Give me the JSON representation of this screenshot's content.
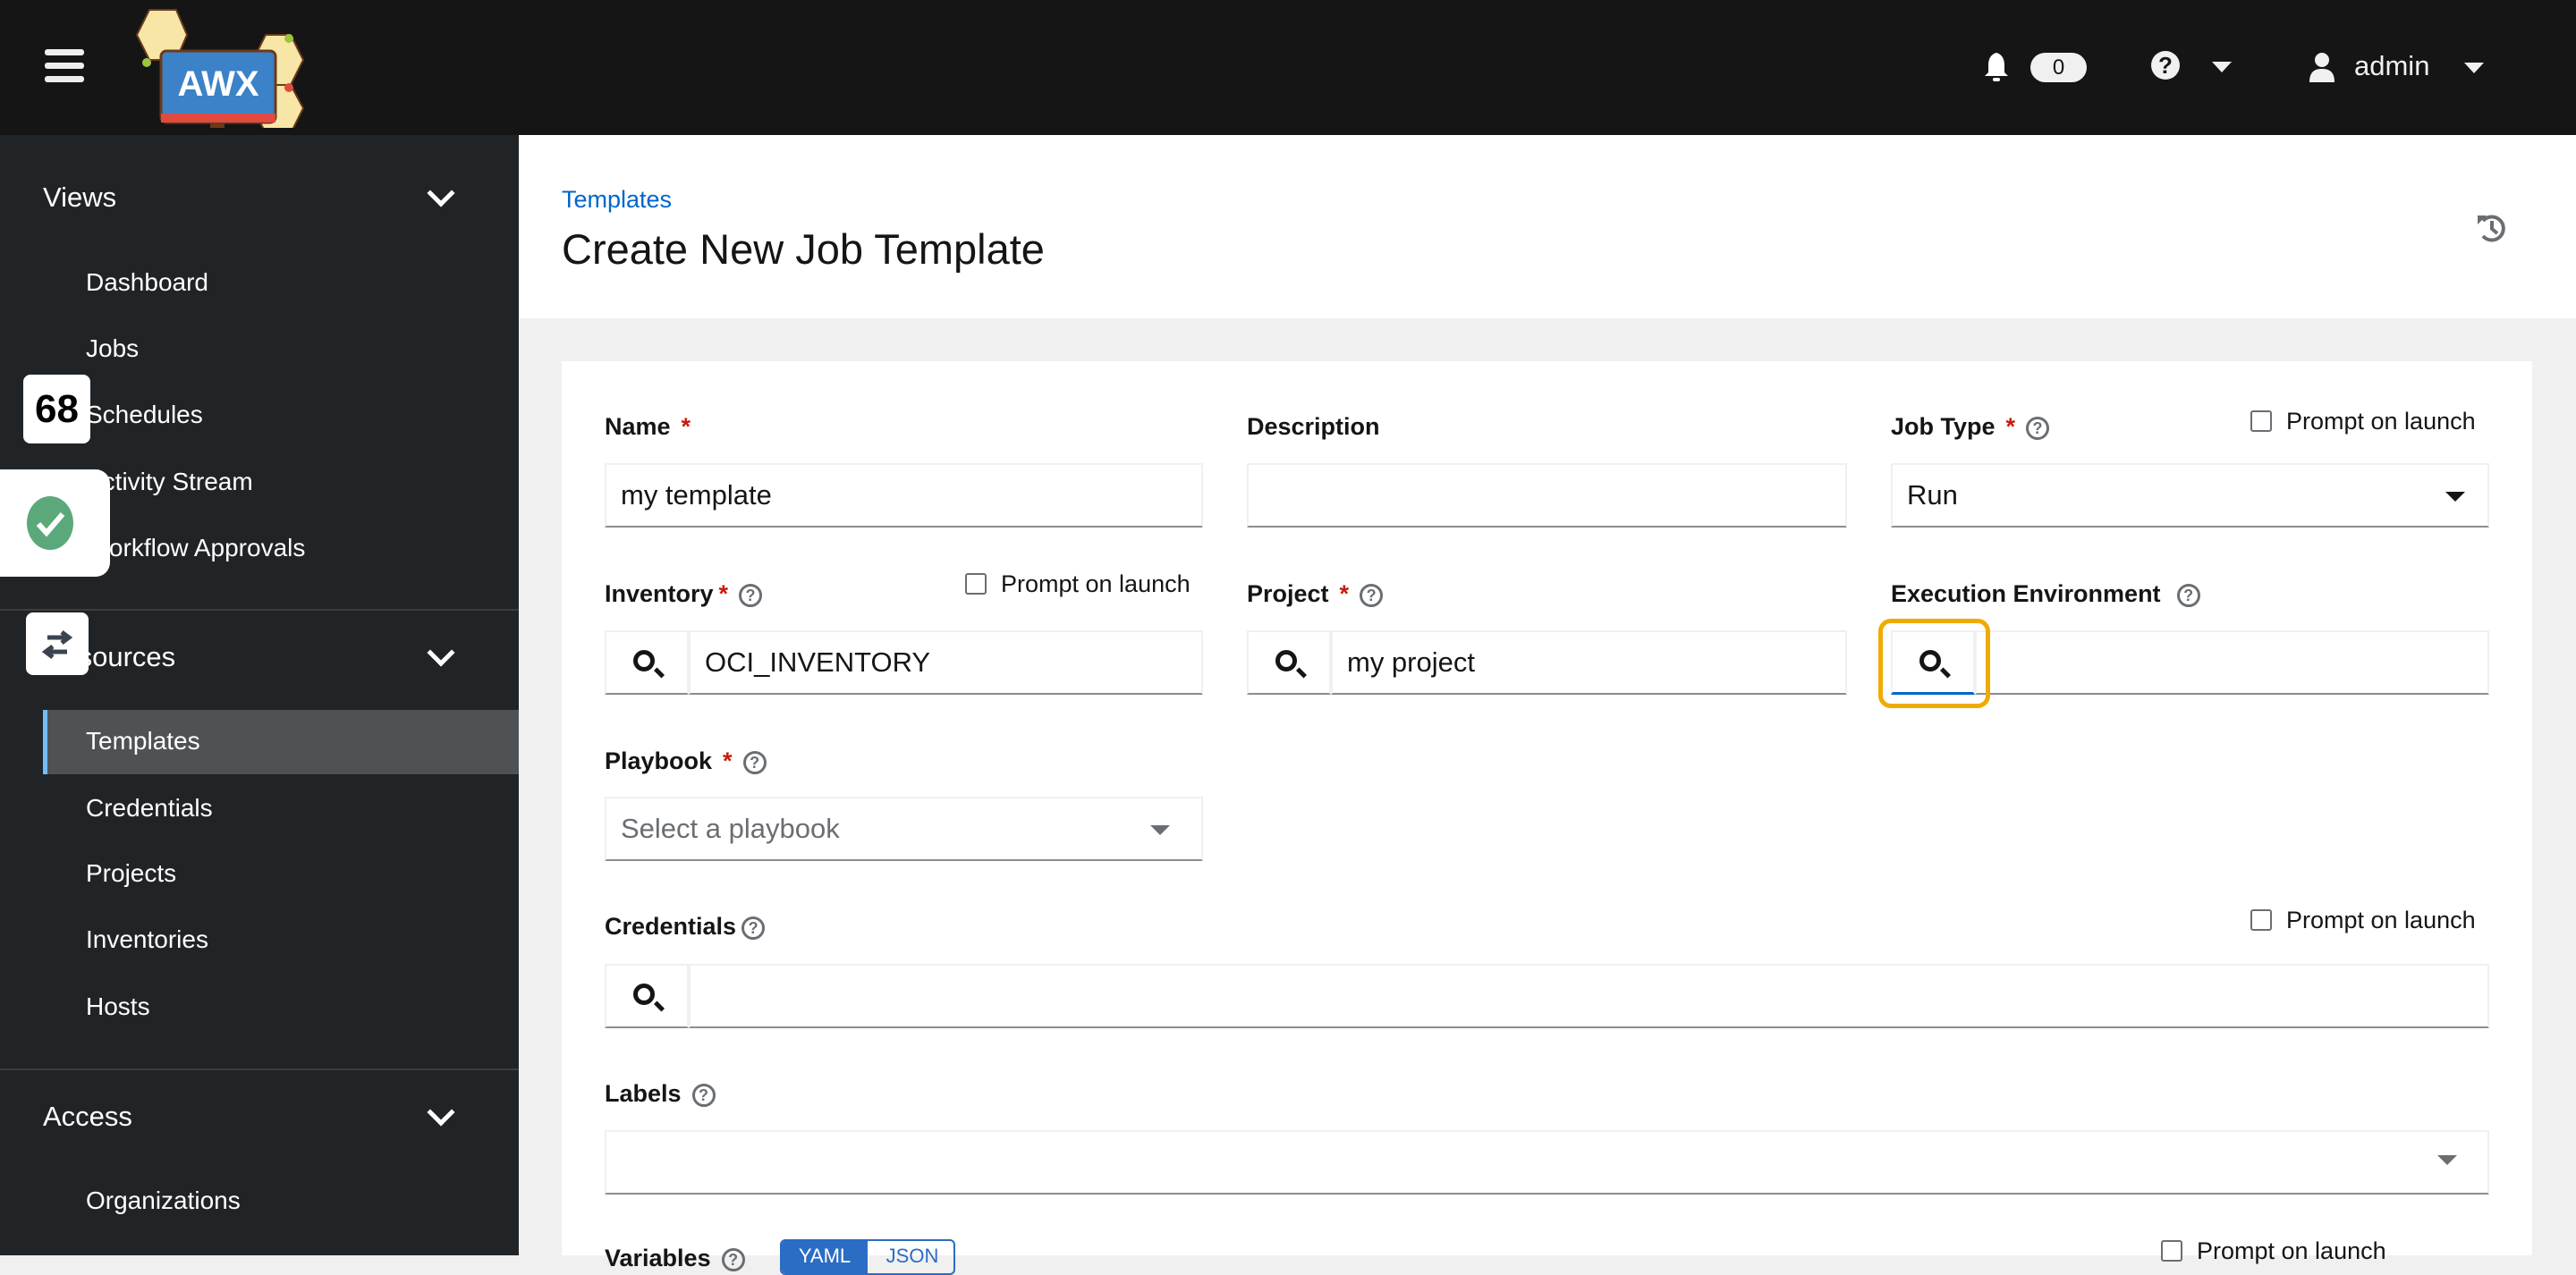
{
  "header": {
    "logo_text": "AWX",
    "notification_count": "0",
    "user": "admin"
  },
  "sidebar": {
    "groups": [
      {
        "label": "Views",
        "items": [
          "Dashboard",
          "Jobs",
          "Schedules",
          "Activity Stream",
          "Workflow Approvals"
        ]
      },
      {
        "label": "Resources",
        "items": [
          "Templates",
          "Credentials",
          "Projects",
          "Inventories",
          "Hosts"
        ]
      },
      {
        "label": "Access",
        "items": [
          "Organizations"
        ]
      }
    ],
    "selected": "Templates"
  },
  "overlays": {
    "counter": "68"
  },
  "page": {
    "breadcrumb": "Templates",
    "title": "Create New Job Template"
  },
  "form": {
    "name": {
      "label": "Name",
      "value": "my template"
    },
    "description": {
      "label": "Description",
      "value": ""
    },
    "job_type": {
      "label": "Job Type",
      "value": "Run"
    },
    "inventory": {
      "label": "Inventory",
      "value": "OCI_INVENTORY"
    },
    "project": {
      "label": "Project",
      "value": "my project"
    },
    "execution_environment": {
      "label": "Execution Environment",
      "value": ""
    },
    "playbook": {
      "label": "Playbook",
      "placeholder": "Select a playbook"
    },
    "credentials": {
      "label": "Credentials",
      "value": ""
    },
    "labels": {
      "label": "Labels",
      "value": ""
    },
    "variables": {
      "label": "Variables",
      "modes": [
        "YAML",
        "JSON"
      ],
      "selected": "YAML"
    },
    "prompt_on_launch": "Prompt on launch",
    "required_mark": "*",
    "help_glyph": "?"
  },
  "colors": {
    "accent": "#0066cc",
    "highlight": "#f0ab00",
    "required": "#c9190b",
    "success": "#5ba97a"
  }
}
